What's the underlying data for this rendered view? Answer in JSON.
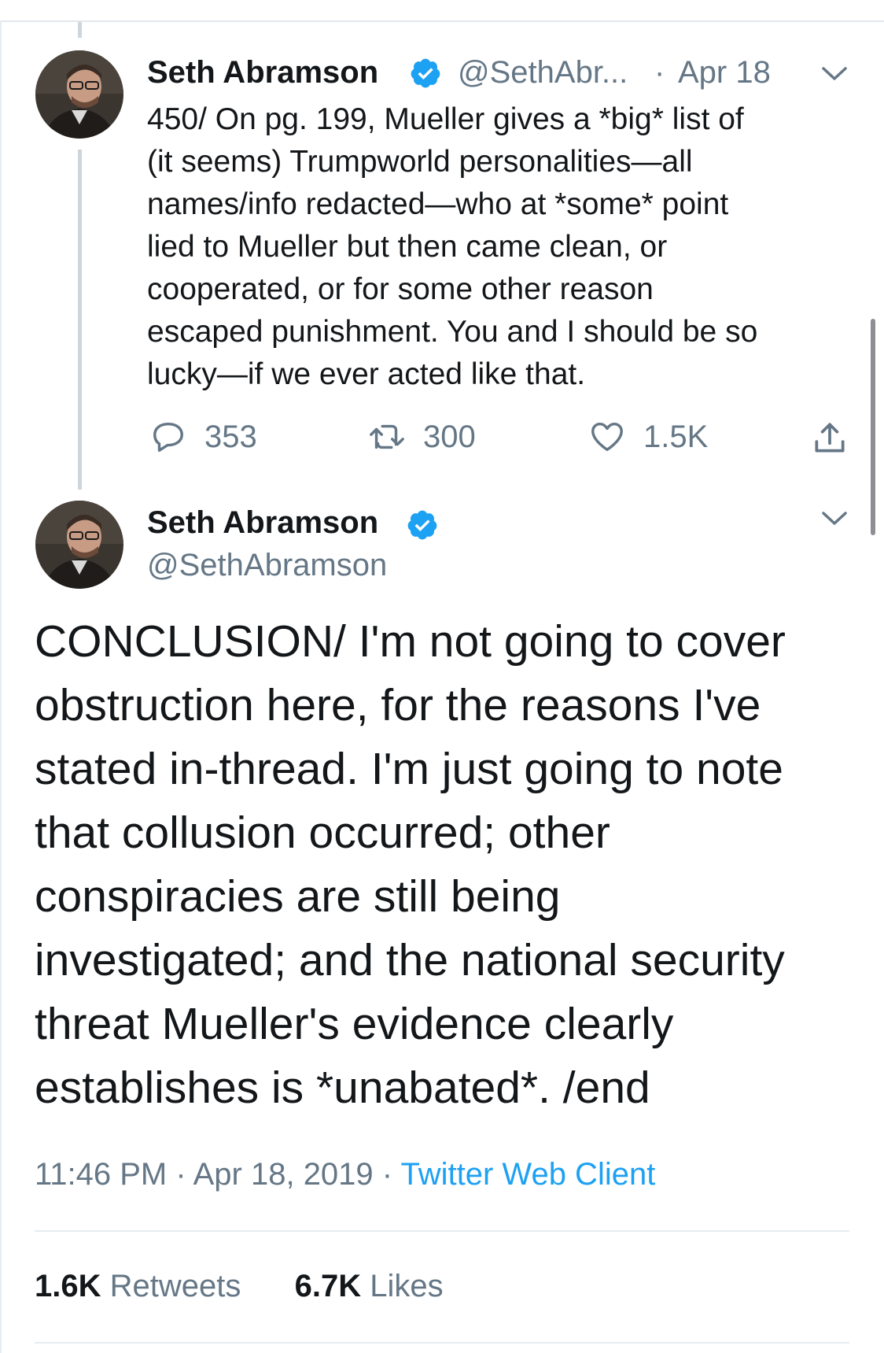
{
  "reply_tweet": {
    "author_name": "Seth Abramson",
    "handle": "@SethAbr...",
    "separator": "·",
    "date": "Apr 18",
    "text": "450/ On pg. 199, Mueller gives a *big* list of\n(it seems) Trumpworld personalities—all\nnames/info redacted—who at *some* point\nlied to Mueller but then came clean, or\ncooperated, or for some other reason\nescaped punishment. You and I should be so\nlucky—if we ever acted like that.",
    "actions": {
      "replies": "353",
      "retweets": "300",
      "likes": "1.5K"
    }
  },
  "main_tweet": {
    "author_name": "Seth Abramson",
    "handle": "@SethAbramson",
    "text": "CONCLUSION/ I'm not going to cover\nobstruction here, for the reasons I've\nstated in-thread. I'm just going to note\nthat collusion occurred; other\nconspiracies are still being\ninvestigated; and the national security\nthreat Mueller's evidence clearly\nestablishes is *unabated*. /end",
    "time": "11:46 PM",
    "date": "Apr 18, 2019",
    "separator": "·",
    "client": "Twitter Web Client",
    "stats": {
      "retweets_count": "1.6K",
      "retweets_label": "Retweets",
      "likes_count": "6.7K",
      "likes_label": "Likes"
    }
  },
  "colors": {
    "verified_badge": "#1da1f2",
    "link": "#1da1f2",
    "secondary_text": "#657786",
    "thread_line": "#ccd6dd"
  },
  "icons": [
    "verified-badge-icon",
    "chevron-down-icon",
    "reply-icon",
    "retweet-icon",
    "like-icon",
    "share-icon"
  ]
}
